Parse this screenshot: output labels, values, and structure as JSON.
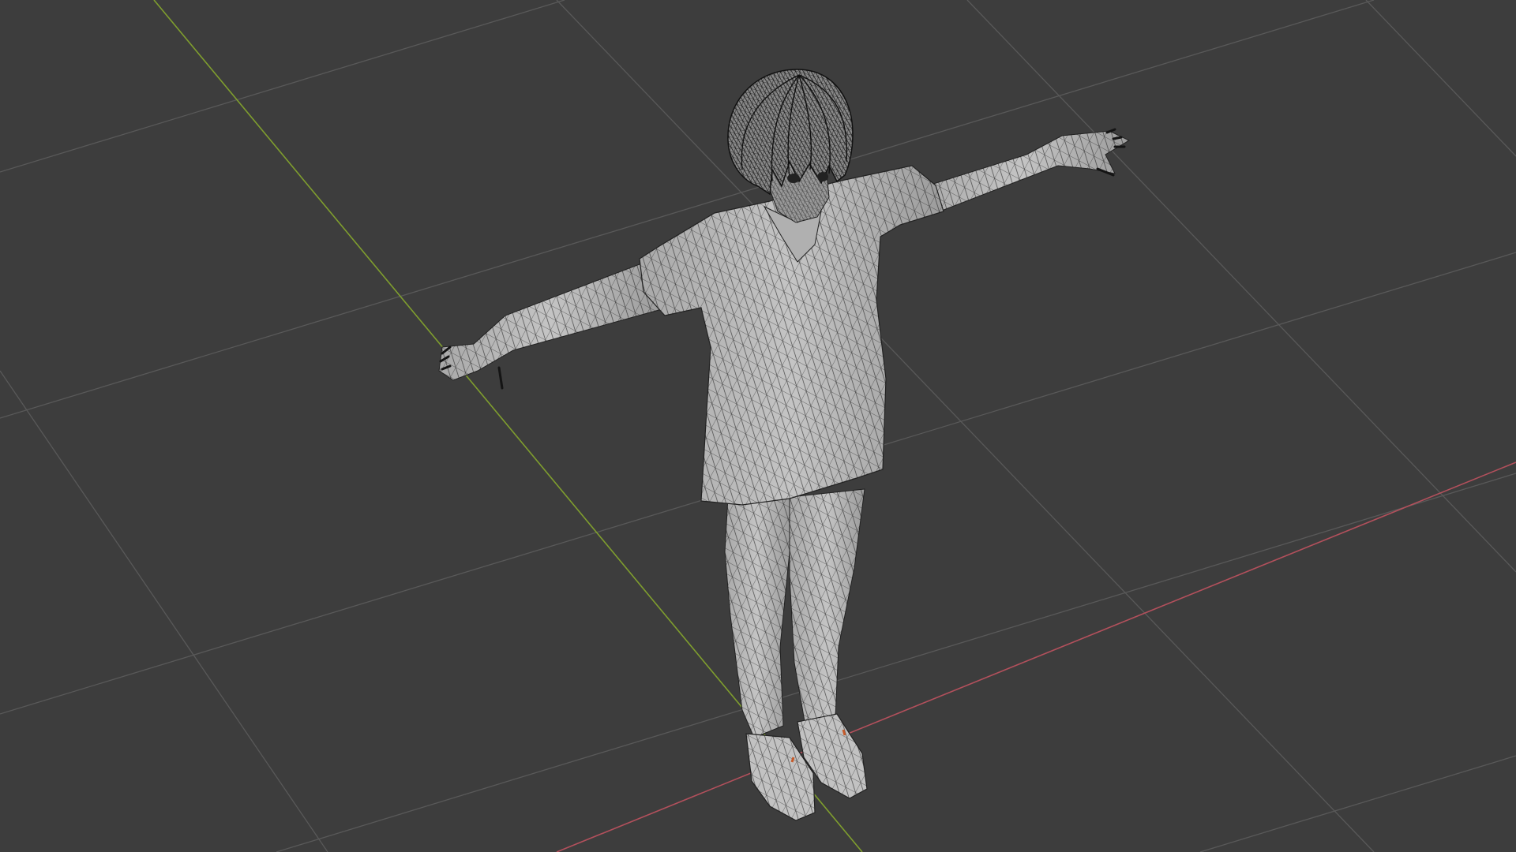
{
  "viewport": {
    "background": "#3d3d3d",
    "grid_color": "#595959",
    "x_axis_color": "#b3505c",
    "y_axis_color": "#7f9e2e",
    "mesh_fill": "#b9b9b9",
    "mesh_wire": "#1c1c1c",
    "shading": "solid-with-wireframe",
    "object": "t-pose-character-mesh"
  }
}
